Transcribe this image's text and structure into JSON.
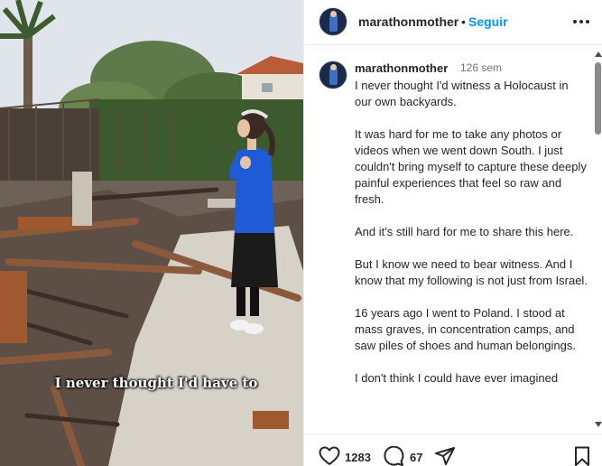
{
  "post": {
    "username": "marathonmother",
    "follow_label": "Seguir",
    "separator": "•"
  },
  "media": {
    "caption": "I never thought I'd have to"
  },
  "comment": {
    "username": "marathonmother",
    "time": "126 sem",
    "paragraphs": [
      "I never thought I'd witness a Holocaust in our own backyards.",
      "It was hard for me to take any photos or videos when we went down South. I just couldn't bring myself to capture these deeply painful experiences that feel so raw and fresh.",
      "And it's still hard for me to share this here.",
      "But I know we need to bear witness. And I know that my following is not just from Israel.",
      "16 years ago I went to Poland. I stood at mass graves, in concentration camps, and saw piles of shoes and human belongings.",
      "I don't think I could have ever imagined"
    ]
  },
  "actions": {
    "likes": "1283",
    "comments": "67"
  },
  "colors": {
    "accent": "#0095f6",
    "text": "#262626",
    "muted": "#737373"
  },
  "icons": [
    "more-options-icon",
    "heart-icon",
    "comment-icon",
    "share-icon",
    "bookmark-icon"
  ]
}
